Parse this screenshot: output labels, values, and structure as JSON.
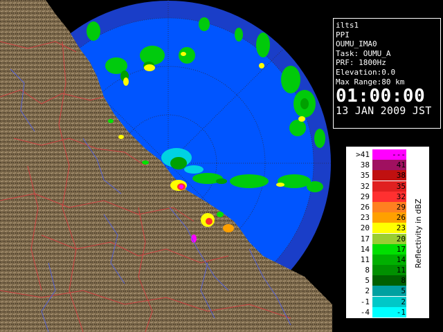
{
  "info": {
    "site": "ilts1",
    "scan_type": "PPI",
    "product": "OUMU_IMA0",
    "task": "Task: OUMU_A",
    "prf": "PRF: 1800Hz",
    "elevation": "Elevation:0.0",
    "max_range": "Max Range:80 km",
    "time": "01:00:00",
    "date": "13 JAN 2009 JST"
  },
  "legend": {
    "unit_label": "Reflectivity in dBZ",
    "rows": [
      {
        "low": ">41",
        "high": "---",
        "color": "#ff00ff"
      },
      {
        "low": "38",
        "high": "41",
        "color": "#a01060"
      },
      {
        "low": "35",
        "high": "38",
        "color": "#c01010"
      },
      {
        "low": "32",
        "high": "35",
        "color": "#e02020"
      },
      {
        "low": "29",
        "high": "32",
        "color": "#ff3030"
      },
      {
        "low": "26",
        "high": "29",
        "color": "#ff8020"
      },
      {
        "low": "23",
        "high": "26",
        "color": "#ffa000"
      },
      {
        "low": "20",
        "high": "23",
        "color": "#ffff00"
      },
      {
        "low": "17",
        "high": "20",
        "color": "#9acd32"
      },
      {
        "low": "14",
        "high": "17",
        "color": "#00e000"
      },
      {
        "low": "11",
        "high": "14",
        "color": "#00b000"
      },
      {
        "low": "8",
        "high": "11",
        "color": "#009000"
      },
      {
        "low": "5",
        "high": "8",
        "color": "#006000"
      },
      {
        "low": "2",
        "high": "5",
        "color": "#00a0a0"
      },
      {
        "low": "-1",
        "high": "2",
        "color": "#00c8c8"
      },
      {
        "low": "-4",
        "high": "-1",
        "color": "#00ffff"
      }
    ]
  },
  "colors": {
    "sea_inner": "#0055ff",
    "sea_outer": "#1a3ec8",
    "land": "#7a6648",
    "prefecture_border": "#d04040",
    "river": "#5060e0",
    "range_ring": "#2a2a2a"
  }
}
